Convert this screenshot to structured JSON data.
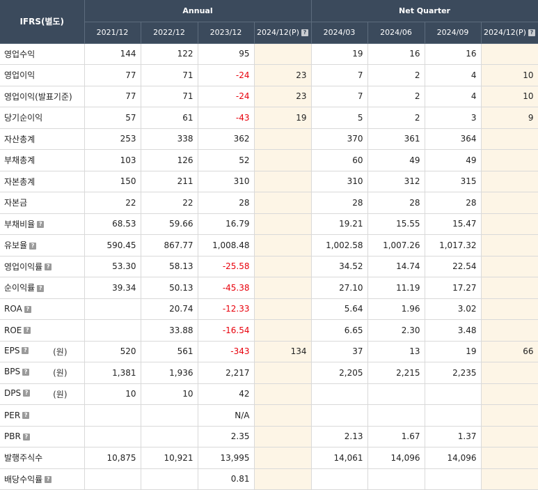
{
  "header": {
    "corner": "IFRS(별도)",
    "group_annual": "Annual",
    "group_quarter": "Net Quarter",
    "columns": [
      "2021/12",
      "2022/12",
      "2023/12",
      "2024/12(P)",
      "2024/03",
      "2024/06",
      "2024/09",
      "2024/12(P)"
    ],
    "hint_icon": "?"
  },
  "rows": [
    {
      "label": "영업수익",
      "hint": false,
      "unit": "",
      "values": [
        "144",
        "122",
        "95",
        "",
        "19",
        "16",
        "16",
        ""
      ],
      "neg": [
        false,
        false,
        false,
        false,
        false,
        false,
        false,
        false
      ]
    },
    {
      "label": "영업이익",
      "hint": false,
      "unit": "",
      "values": [
        "77",
        "71",
        "-24",
        "23",
        "7",
        "2",
        "4",
        "10"
      ],
      "neg": [
        false,
        false,
        true,
        false,
        false,
        false,
        false,
        false
      ]
    },
    {
      "label": "영업이익(발표기준)",
      "hint": false,
      "unit": "",
      "values": [
        "77",
        "71",
        "-24",
        "23",
        "7",
        "2",
        "4",
        "10"
      ],
      "neg": [
        false,
        false,
        true,
        false,
        false,
        false,
        false,
        false
      ]
    },
    {
      "label": "당기순이익",
      "hint": false,
      "unit": "",
      "values": [
        "57",
        "61",
        "-43",
        "19",
        "5",
        "2",
        "3",
        "9"
      ],
      "neg": [
        false,
        false,
        true,
        false,
        false,
        false,
        false,
        false
      ]
    },
    {
      "label": "자산총계",
      "hint": false,
      "unit": "",
      "values": [
        "253",
        "338",
        "362",
        "",
        "370",
        "361",
        "364",
        ""
      ],
      "neg": [
        false,
        false,
        false,
        false,
        false,
        false,
        false,
        false
      ]
    },
    {
      "label": "부채총계",
      "hint": false,
      "unit": "",
      "values": [
        "103",
        "126",
        "52",
        "",
        "60",
        "49",
        "49",
        ""
      ],
      "neg": [
        false,
        false,
        false,
        false,
        false,
        false,
        false,
        false
      ]
    },
    {
      "label": "자본총계",
      "hint": false,
      "unit": "",
      "values": [
        "150",
        "211",
        "310",
        "",
        "310",
        "312",
        "315",
        ""
      ],
      "neg": [
        false,
        false,
        false,
        false,
        false,
        false,
        false,
        false
      ]
    },
    {
      "label": "자본금",
      "hint": false,
      "unit": "",
      "values": [
        "22",
        "22",
        "28",
        "",
        "28",
        "28",
        "28",
        ""
      ],
      "neg": [
        false,
        false,
        false,
        false,
        false,
        false,
        false,
        false
      ]
    },
    {
      "label": "부채비율",
      "hint": true,
      "unit": "",
      "values": [
        "68.53",
        "59.66",
        "16.79",
        "",
        "19.21",
        "15.55",
        "15.47",
        ""
      ],
      "neg": [
        false,
        false,
        false,
        false,
        false,
        false,
        false,
        false
      ]
    },
    {
      "label": "유보율",
      "hint": true,
      "unit": "",
      "values": [
        "590.45",
        "867.77",
        "1,008.48",
        "",
        "1,002.58",
        "1,007.26",
        "1,017.32",
        ""
      ],
      "neg": [
        false,
        false,
        false,
        false,
        false,
        false,
        false,
        false
      ]
    },
    {
      "label": "영업이익률",
      "hint": true,
      "unit": "",
      "values": [
        "53.30",
        "58.13",
        "-25.58",
        "",
        "34.52",
        "14.74",
        "22.54",
        ""
      ],
      "neg": [
        false,
        false,
        true,
        false,
        false,
        false,
        false,
        false
      ]
    },
    {
      "label": "순이익률",
      "hint": true,
      "unit": "",
      "values": [
        "39.34",
        "50.13",
        "-45.38",
        "",
        "27.10",
        "11.19",
        "17.27",
        ""
      ],
      "neg": [
        false,
        false,
        true,
        false,
        false,
        false,
        false,
        false
      ]
    },
    {
      "label": "ROA",
      "hint": true,
      "unit": "",
      "values": [
        "",
        "20.74",
        "-12.33",
        "",
        "5.64",
        "1.96",
        "3.02",
        ""
      ],
      "neg": [
        false,
        false,
        true,
        false,
        false,
        false,
        false,
        false
      ]
    },
    {
      "label": "ROE",
      "hint": true,
      "unit": "",
      "values": [
        "",
        "33.88",
        "-16.54",
        "",
        "6.65",
        "2.30",
        "3.48",
        ""
      ],
      "neg": [
        false,
        false,
        true,
        false,
        false,
        false,
        false,
        false
      ]
    },
    {
      "label": "EPS",
      "hint": true,
      "unit": "(원)",
      "values": [
        "520",
        "561",
        "-343",
        "134",
        "37",
        "13",
        "19",
        "66"
      ],
      "neg": [
        false,
        false,
        true,
        false,
        false,
        false,
        false,
        false
      ]
    },
    {
      "label": "BPS",
      "hint": true,
      "unit": "(원)",
      "values": [
        "1,381",
        "1,936",
        "2,217",
        "",
        "2,205",
        "2,215",
        "2,235",
        ""
      ],
      "neg": [
        false,
        false,
        false,
        false,
        false,
        false,
        false,
        false
      ]
    },
    {
      "label": "DPS",
      "hint": true,
      "unit": "(원)",
      "values": [
        "10",
        "10",
        "42",
        "",
        "",
        "",
        "",
        ""
      ],
      "neg": [
        false,
        false,
        false,
        false,
        false,
        false,
        false,
        false
      ]
    },
    {
      "label": "PER",
      "hint": true,
      "unit": "",
      "values": [
        "",
        "",
        "N/A",
        "",
        "",
        "",
        "",
        ""
      ],
      "neg": [
        false,
        false,
        false,
        false,
        false,
        false,
        false,
        false
      ]
    },
    {
      "label": "PBR",
      "hint": true,
      "unit": "",
      "values": [
        "",
        "",
        "2.35",
        "",
        "2.13",
        "1.67",
        "1.37",
        ""
      ],
      "neg": [
        false,
        false,
        false,
        false,
        false,
        false,
        false,
        false
      ]
    },
    {
      "label": "발행주식수",
      "hint": false,
      "unit": "",
      "values": [
        "10,875",
        "10,921",
        "13,995",
        "",
        "14,061",
        "14,096",
        "14,096",
        ""
      ],
      "neg": [
        false,
        false,
        false,
        false,
        false,
        false,
        false,
        false
      ]
    },
    {
      "label": "배당수익률",
      "hint": true,
      "unit": "",
      "values": [
        "",
        "",
        "0.81",
        "",
        "",
        "",
        "",
        ""
      ],
      "neg": [
        false,
        false,
        false,
        false,
        false,
        false,
        false,
        false
      ]
    }
  ],
  "colors": {
    "header_bg": "#3b4a5c",
    "projection_bg": "#fdf5e6",
    "negative": "#e8000b"
  }
}
